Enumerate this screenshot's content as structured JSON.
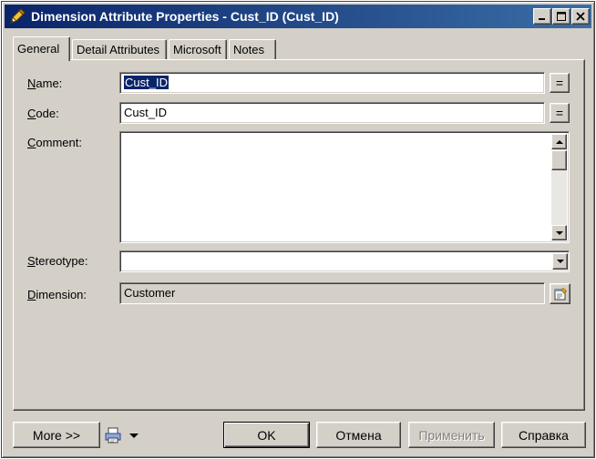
{
  "window": {
    "title": "Dimension Attribute Properties - Cust_ID (Cust_ID)"
  },
  "tabs": [
    {
      "label": "General",
      "active": true
    },
    {
      "label": "Detail Attributes",
      "active": false
    },
    {
      "label": "Microsoft",
      "active": false
    },
    {
      "label": "Notes",
      "active": false
    }
  ],
  "form": {
    "name": {
      "label_first": "N",
      "label_rest": "ame:",
      "value": "Cust_ID"
    },
    "code": {
      "label_first": "C",
      "label_rest": "ode:",
      "value": "Cust_ID"
    },
    "comment": {
      "label_first": "C",
      "label_rest": "omment:",
      "value": ""
    },
    "stereotype": {
      "label_first": "S",
      "label_rest": "tereotype:",
      "value": ""
    },
    "dimension": {
      "label_first": "D",
      "label_rest": "imension:",
      "value": "Customer"
    },
    "equals_label": "="
  },
  "footer": {
    "more_label": "More >>",
    "ok_label": "OK",
    "cancel_label": "Отмена",
    "apply_label": "Применить",
    "help_label": "Справка"
  },
  "colors": {
    "titlebar_start": "#0a246a",
    "titlebar_end": "#3a6ea5",
    "face": "#d4d0c8",
    "selection": "#0a246a"
  }
}
